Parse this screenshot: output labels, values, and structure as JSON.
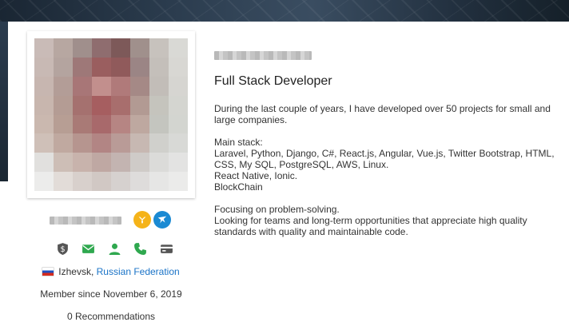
{
  "profile": {
    "title": "Full Stack Developer",
    "bio": [
      "During the last couple of years, I have developed over 50 projects for small and large companies.",
      "",
      "Main stack:",
      "Laravel, Python, Django, C#, React.js, Angular, Vue.js, Twitter Bootstrap, HTML, CSS, My SQL, PostgreSQL, AWS, Linux.",
      "React Native, Ionic.",
      "BlockChain",
      "",
      "Focusing on problem-solving.",
      "Looking for teams and long-term opportunities that appreciate high quality standards with quality and maintainable code."
    ],
    "location": {
      "city": "Izhevsk, ",
      "country": "Russian Federation",
      "flag": "russia-flag"
    },
    "member_since": "Member since November 6, 2019",
    "recommendations": "0 Recommendations"
  },
  "badges": [
    {
      "icon": "top-rated-badge-icon",
      "color": "#f5b319"
    },
    {
      "icon": "freelancer-badge-icon",
      "color": "#1b8ad3"
    }
  ],
  "verifications": [
    {
      "icon": "shield-dollar-icon",
      "color": "#555555"
    },
    {
      "icon": "email-icon",
      "color": "#2fa84f"
    },
    {
      "icon": "user-icon",
      "color": "#2fa84f"
    },
    {
      "icon": "phone-icon",
      "color": "#2fa84f"
    },
    {
      "icon": "card-icon",
      "color": "#555555"
    }
  ],
  "colors": {
    "link": "#1a73c7",
    "text": "#333333",
    "banner": "#2b3c4e"
  }
}
